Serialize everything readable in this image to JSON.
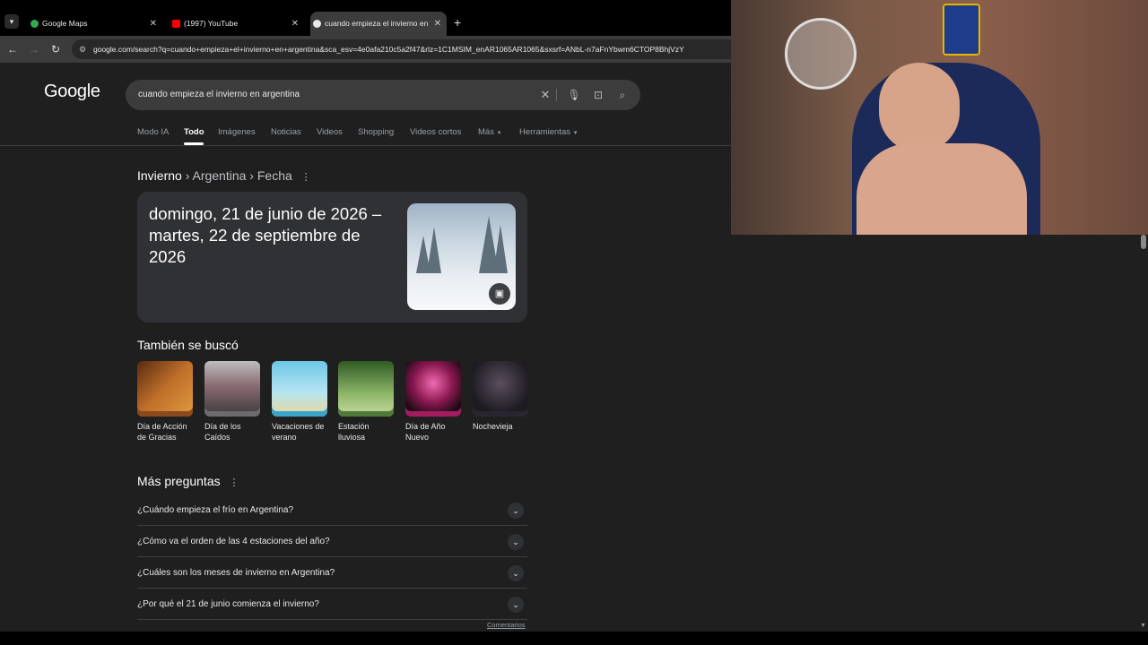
{
  "browser": {
    "tabs": [
      {
        "label": "Google Maps",
        "favicon": "maps-icon",
        "active": false
      },
      {
        "label": "(1997) YouTube",
        "favicon": "youtube-icon",
        "active": false
      },
      {
        "label": "cuando empieza el invierno en",
        "favicon": "google-icon",
        "active": true
      }
    ],
    "url": "google.com/search?q=cuando+empieza+el+invierno+en+argentina&sca_esv=4e0afa210c5a2f47&rlz=1C1MSIM_enAR1065AR1065&sxsrf=ANbL-n7aFnYbwm6CTOP8BhjVzY"
  },
  "search": {
    "logo": "Google",
    "query": "cuando empieza el invierno en argentina"
  },
  "nav_tabs": [
    "Modo IA",
    "Todo",
    "Imágenes",
    "Noticias",
    "Videos",
    "Shopping",
    "Videos cortos",
    "Más",
    "Herramientas"
  ],
  "breadcrumb": {
    "first": "Invierno",
    "rest": "› Argentina › Fecha"
  },
  "answer": {
    "text": "domingo, 21 de junio de 2026 – martes, 22 de septiembre de 2026"
  },
  "also_searched": {
    "title": "También se buscó",
    "items": [
      {
        "label": "Día de Acción de Gracias",
        "color": "#8a4a1e"
      },
      {
        "label": "Día de los Caídos",
        "color": "#6e6a6d"
      },
      {
        "label": "Vacaciones de verano",
        "color": "#3aa5c6"
      },
      {
        "label": "Estación lluviosa",
        "color": "#4f7a3a"
      },
      {
        "label": "Día de Año Nuevo",
        "color": "#a11d5d"
      },
      {
        "label": "Nochevieja",
        "color": "#2a2530"
      }
    ]
  },
  "more_questions": {
    "title": "Más preguntas",
    "items": [
      "¿Cuándo empieza el frío en Argentina?",
      "¿Cómo va el orden de las 4 estaciones del año?",
      "¿Cuáles son los meses de invierno en Argentina?",
      "¿Por qué el 21 de junio comienza el invierno?"
    ]
  },
  "feedback": "Comentarios"
}
